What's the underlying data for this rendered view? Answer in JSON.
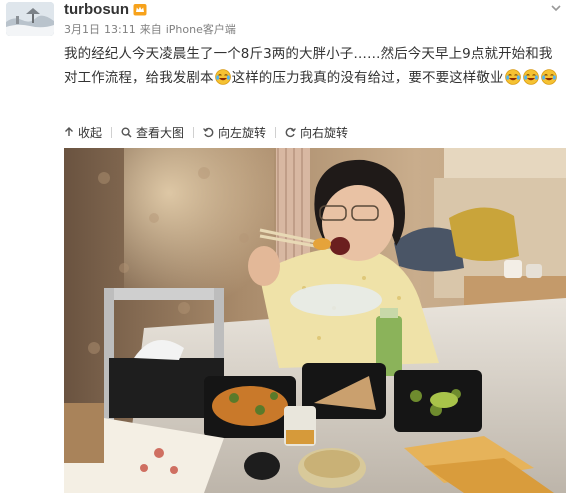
{
  "user": {
    "username": "turbosun",
    "avatar_icon": "snow-landscape-avatar",
    "badge_icon": "vip-crown-icon"
  },
  "meta": {
    "date": "3月1日",
    "time": "13:11",
    "source_prefix": "来自",
    "source": "iPhone客户端"
  },
  "post": {
    "text_part1": "我的经纪人今天凌晨生了一个8斤3两的大胖小子……然后今天早上9点就开始和我对工作流程，给我发剧本",
    "text_part2": "这样的压力我真的没有给过，要不要这样敬业",
    "emoji_icon": "laugh-cry-emoji"
  },
  "toolbar": {
    "collapse_label": "收起",
    "view_large_label": "查看大图",
    "rotate_left_label": "向左旋转",
    "rotate_right_label": "向右旋转"
  },
  "colors": {
    "text": "#333333",
    "meta": "#808080",
    "emoji": "#f5c232"
  }
}
